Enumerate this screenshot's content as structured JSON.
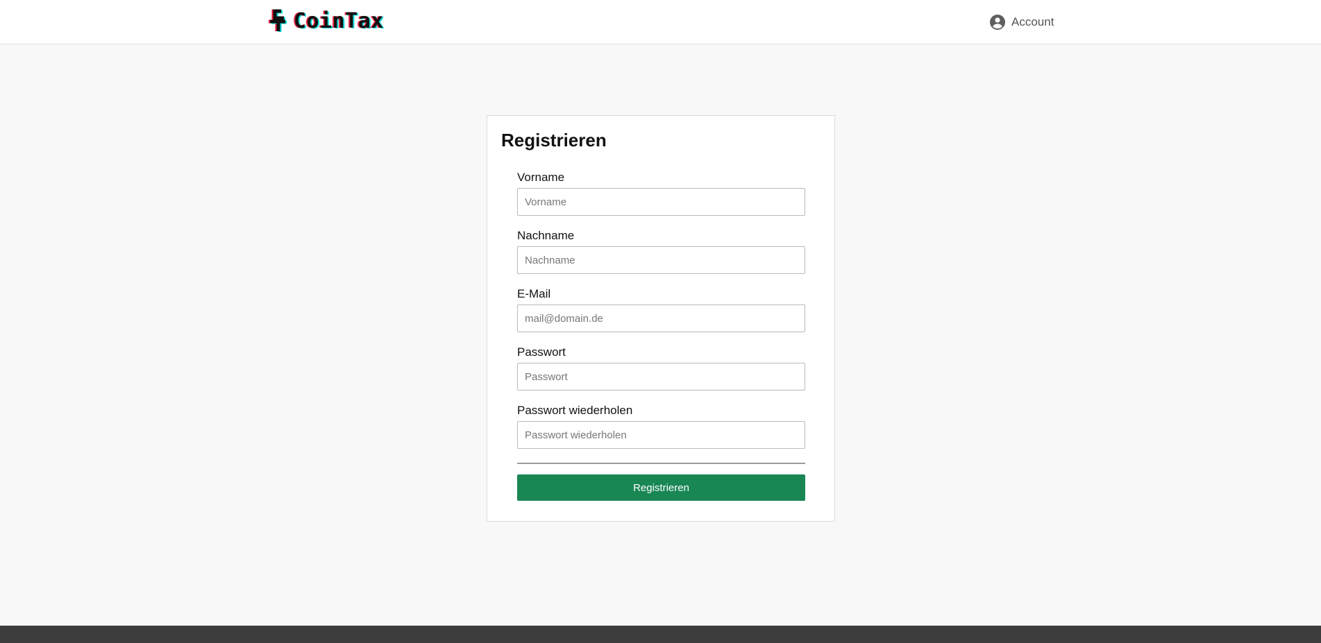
{
  "header": {
    "logo_text": "CoinTax",
    "logo_icon": "coin-letter-c-icon",
    "account_label": "Account",
    "account_icon": "account-circle-icon"
  },
  "register_form": {
    "title": "Registrieren",
    "fields": [
      {
        "label": "Vorname",
        "placeholder": "Vorname",
        "value": ""
      },
      {
        "label": "Nachname",
        "placeholder": "Nachname",
        "value": ""
      },
      {
        "label": "E-Mail",
        "placeholder": "mail@domain.de",
        "value": ""
      },
      {
        "label": "Passwort",
        "placeholder": "Passwort",
        "value": ""
      },
      {
        "label": "Passwort wiederholen",
        "placeholder": "Passwort wiederholen",
        "value": ""
      }
    ],
    "submit_label": "Registrieren"
  },
  "colors": {
    "primary_button": "#198754",
    "footer": "#3c3c3c",
    "page_background": "#f8f8f8",
    "logo_glitch_red": "#e61e3c",
    "logo_glitch_cyan": "#00d7d7"
  }
}
